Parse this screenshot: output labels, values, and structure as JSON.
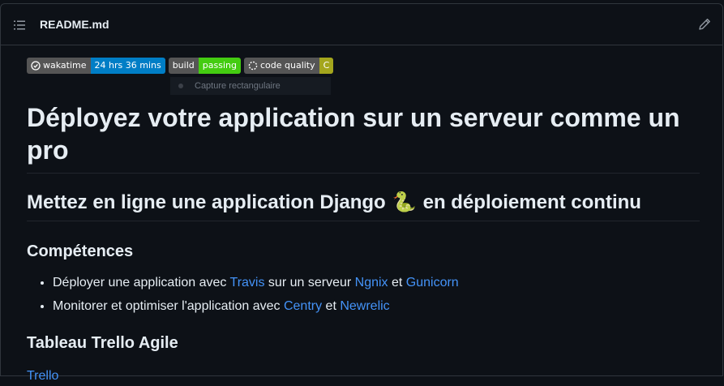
{
  "file": {
    "name": "README.md",
    "toc_icon": "list-icon",
    "edit_icon": "pencil-icon"
  },
  "badges": [
    {
      "label": "wakatime",
      "value": "24 hrs 36 mins",
      "color": "#007ec6",
      "icon": "clock-icon"
    },
    {
      "label": "build",
      "value": "passing",
      "color": "#4c1"
    },
    {
      "label": "code quality",
      "value": "C",
      "color": "#a4a61d",
      "icon": "spinner-icon"
    }
  ],
  "tooltip": {
    "text": "Capture rectangulaire"
  },
  "title": "Déployez votre application sur un serveur comme un pro",
  "subtitle": {
    "before": "Mettez en ligne une application Django",
    "emoji": "🐍",
    "after": "en déploiement continu"
  },
  "skills": {
    "heading": "Compétences",
    "items": [
      {
        "prefix": "Déployer une application avec ",
        "link1": "Travis",
        "middle": " sur un serveur ",
        "link2": "Ngnix",
        "connector": " et ",
        "link3": "Gunicorn"
      },
      {
        "prefix": "Monitorer et optimiser l'application avec ",
        "link1": "Centry",
        "connector": " et ",
        "link2": "Newrelic"
      }
    ]
  },
  "trello": {
    "heading": "Tableau Trello Agile",
    "link": "Trello"
  },
  "colors": {
    "background": "#0d1117",
    "link": "#4493f8",
    "text": "#e6edf3",
    "border": "#30363d"
  }
}
